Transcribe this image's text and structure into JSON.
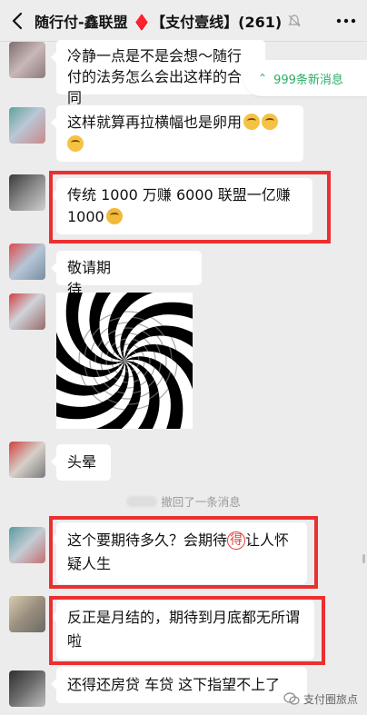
{
  "header": {
    "title": "随行付-鑫联盟 ♦️【支付壹线】(261)",
    "accent": "#ededed"
  },
  "new_messages": {
    "label": "999条新消息",
    "color": "#2aae67"
  },
  "messages": [
    {
      "text": "冷静一点是不是会想～随行付的法务怎么会出这样的合同"
    },
    {
      "text": "这样就算再拉横幅也是卵用"
    },
    {
      "text": "传统 1000 万赚 6000 联盟一亿赚 1000"
    },
    {
      "text": "敬请期待………………"
    },
    {
      "text": "头晕"
    },
    {
      "text": "这个要期待多久？会期待",
      "circled": "得",
      "text_after": "让人怀疑人生"
    },
    {
      "text": "反正是月结的，期待到月底都无所谓啦"
    },
    {
      "text": "还得还房贷 车贷 这下指望不上了"
    }
  ],
  "system_notice": {
    "text": "撤回了一条消息"
  },
  "watermark": {
    "text": "支付圈旅点"
  },
  "highlight_color": "#ec2f2f"
}
